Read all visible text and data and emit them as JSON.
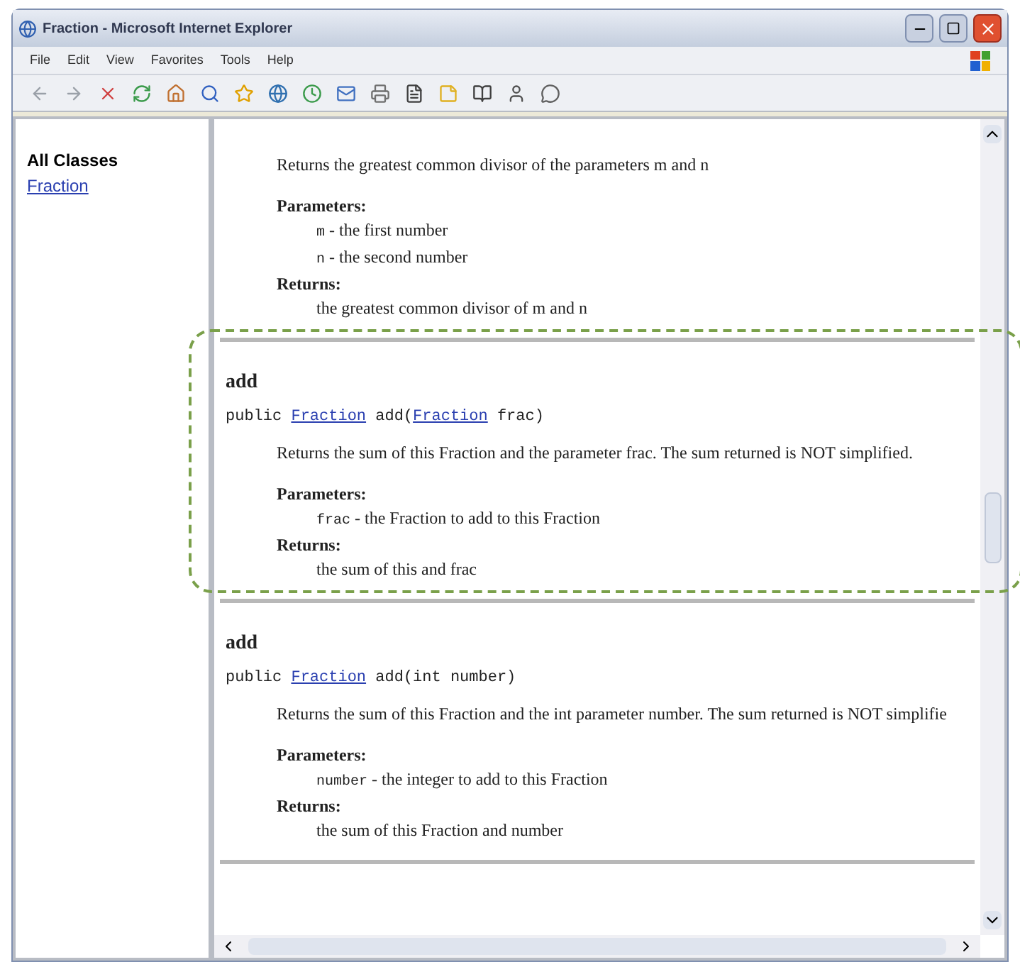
{
  "window": {
    "title": "Fraction - Microsoft Internet Explorer"
  },
  "menu": [
    "File",
    "Edit",
    "View",
    "Favorites",
    "Tools",
    "Help"
  ],
  "sidebar": {
    "heading": "All Classes",
    "links": [
      "Fraction"
    ]
  },
  "methods": [
    {
      "description": "Returns the greatest common divisor of the parameters m and n",
      "parameters_label": "Parameters:",
      "parameters": [
        {
          "name": "m",
          "text": " - the first number"
        },
        {
          "name": "n",
          "text": " - the second number"
        }
      ],
      "returns_label": "Returns:",
      "returns": "the greatest common divisor of m and n",
      "highlighted": false
    },
    {
      "heading": "add",
      "signature": [
        {
          "kind": "text",
          "text": "public "
        },
        {
          "kind": "link",
          "text": "Fraction"
        },
        {
          "kind": "text",
          "text": " add("
        },
        {
          "kind": "link",
          "text": "Fraction"
        },
        {
          "kind": "text",
          "text": " frac)"
        }
      ],
      "description": "Returns the sum of this Fraction and the parameter frac. The sum returned is NOT simplified.",
      "parameters_label": "Parameters:",
      "parameters": [
        {
          "name": "frac",
          "text": " - the Fraction to add to this Fraction"
        }
      ],
      "returns_label": "Returns:",
      "returns": "the sum of this and frac",
      "highlighted": true
    },
    {
      "heading": "add",
      "signature": [
        {
          "kind": "text",
          "text": "public "
        },
        {
          "kind": "link",
          "text": "Fraction"
        },
        {
          "kind": "text",
          "text": " add(int number)"
        }
      ],
      "description": "Returns the sum of this Fraction and the int parameter number. The sum returned is NOT simplifie",
      "parameters_label": "Parameters:",
      "parameters": [
        {
          "name": "number",
          "text": " - the integer to add to this Fraction"
        }
      ],
      "returns_label": "Returns:",
      "returns": "the sum of this Fraction and number",
      "highlighted": false
    }
  ]
}
